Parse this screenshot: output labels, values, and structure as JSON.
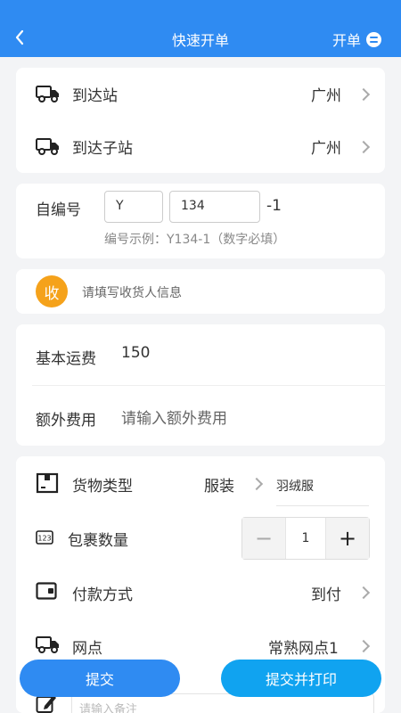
{
  "header": {
    "title": "快速开单",
    "menu_label": "开单"
  },
  "station": {
    "arrival_label": "到达站",
    "arrival_value": "广州",
    "sub_label": "到达子站",
    "sub_value": "广州"
  },
  "serial": {
    "label": "自编号",
    "prefix_value": "Y",
    "number_value": "134",
    "suffix": "-1",
    "hint": "编号示例：Y134-1（数字必填）"
  },
  "receiver": {
    "badge": "收",
    "placeholder": "请填写收货人信息"
  },
  "fees": {
    "base_label": "基本运费",
    "base_value": "150",
    "extra_label": "额外费用",
    "extra_placeholder": "请输入额外费用"
  },
  "goods": {
    "type_label": "货物类型",
    "type_value": "服装",
    "sub_type": "羽绒服",
    "qty_label": "包裹数量",
    "qty_value": "1",
    "pay_label": "付款方式",
    "pay_value": "到付",
    "site_label": "网点",
    "site_value": "常熟网点1",
    "note_placeholder": "请输入备注"
  },
  "actions": {
    "submit": "提交",
    "submit_print": "提交并打印"
  },
  "colors": {
    "primary": "#2f8bf2",
    "secondary": "#10a3f0",
    "badge": "#f5a21b"
  }
}
